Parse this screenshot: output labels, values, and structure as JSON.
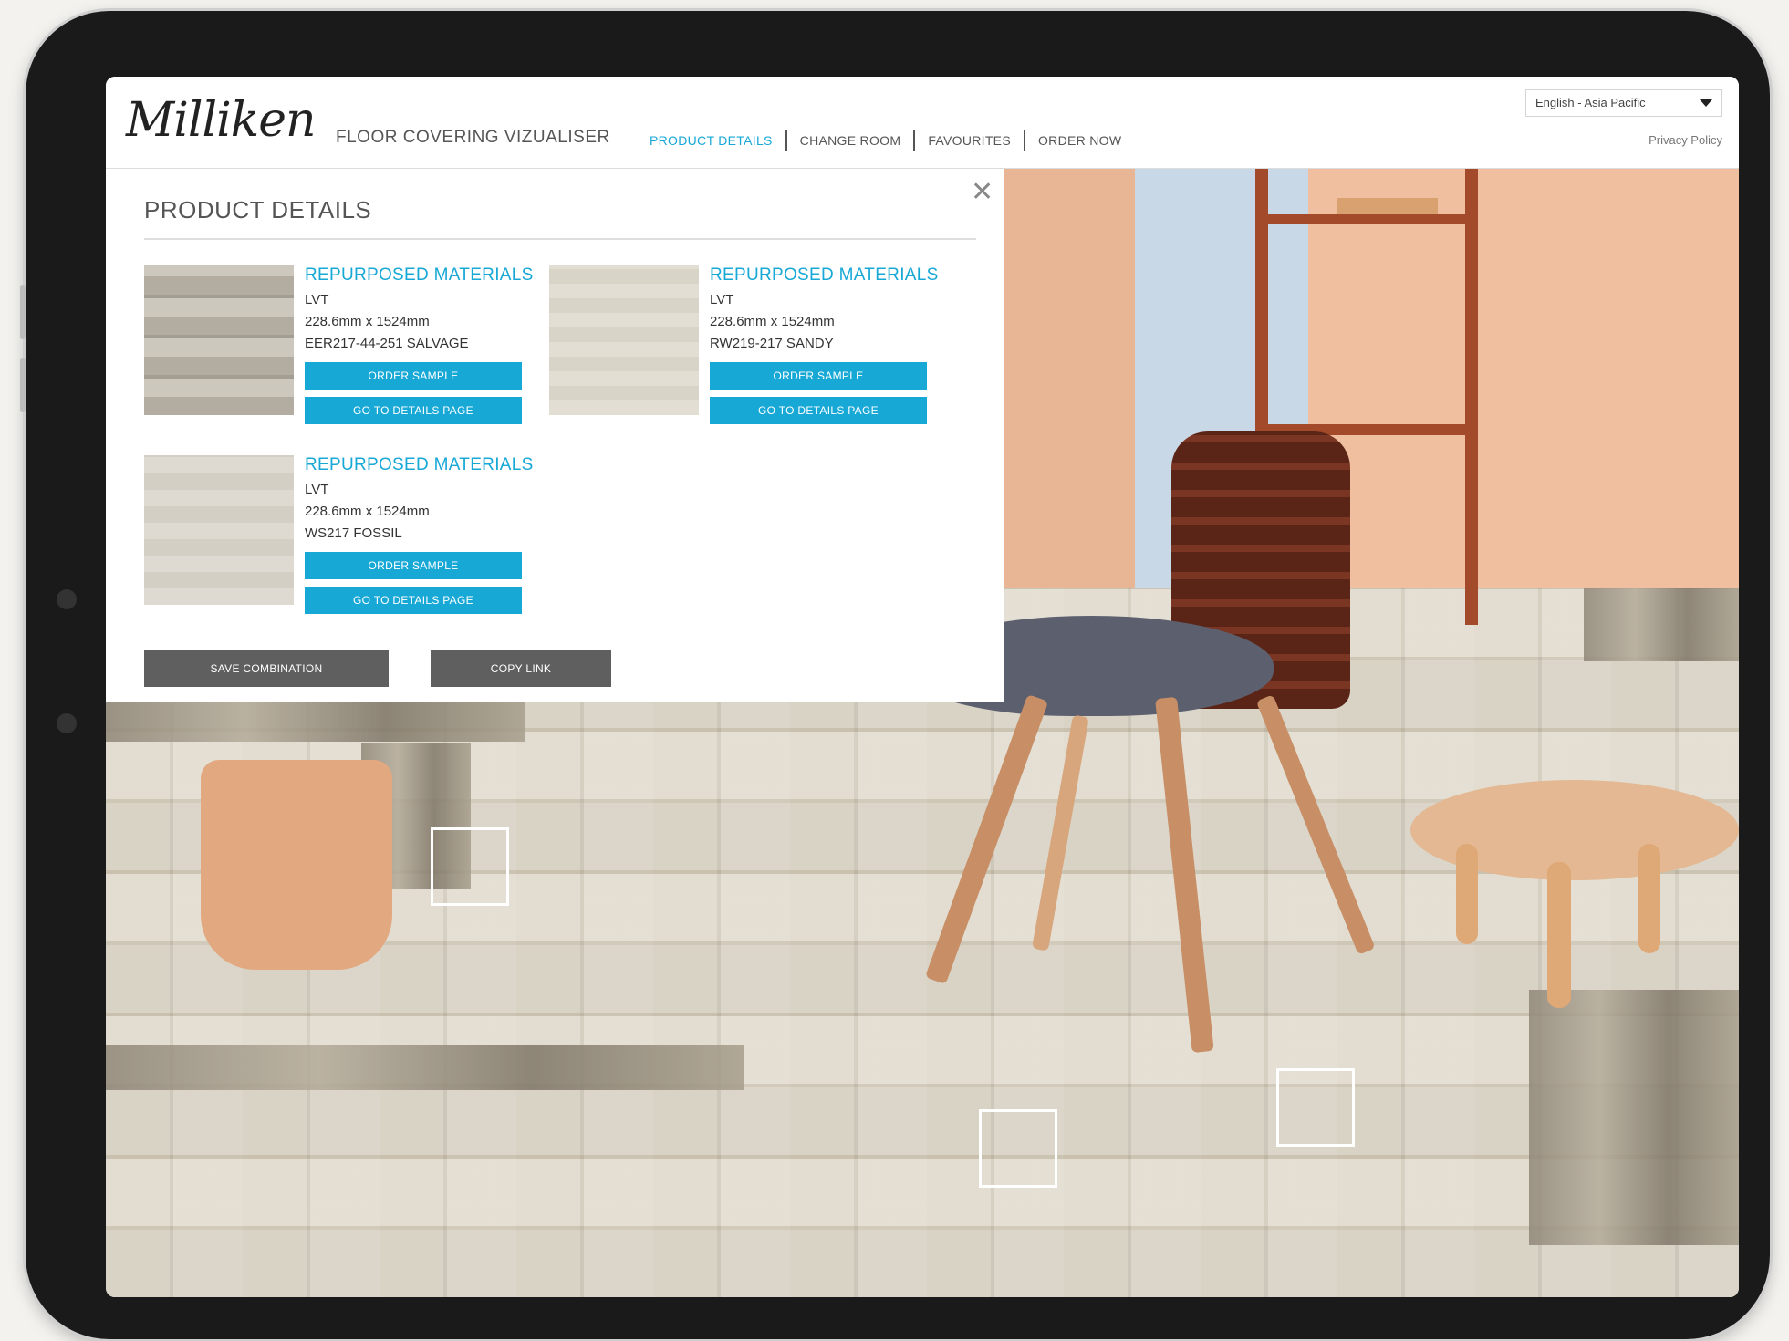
{
  "header": {
    "logo": "Milliken",
    "app_title": "FLOOR COVERING VIZUALISER",
    "nav": [
      "PRODUCT DETAILS",
      "CHANGE ROOM",
      "FAVOURITES",
      "ORDER NOW"
    ],
    "active_nav": "PRODUCT DETAILS",
    "language": "English - Asia Pacific",
    "privacy": "Privacy Policy"
  },
  "panel": {
    "title": "PRODUCT DETAILS",
    "products": [
      {
        "name": "REPURPOSED MATERIALS",
        "type": "LVT",
        "size": "228.6mm x 1524mm",
        "code": "EER217-44-251 SALVAGE",
        "swatch_color": "#bfbab0",
        "order_label": "ORDER SAMPLE",
        "details_label": "GO TO DETAILS PAGE"
      },
      {
        "name": "REPURPOSED MATERIALS",
        "type": "LVT",
        "size": "228.6mm x 1524mm",
        "code": "RW219-217 SANDY",
        "swatch_color": "#e0dcd2",
        "order_label": "ORDER SAMPLE",
        "details_label": "GO TO DETAILS PAGE"
      },
      {
        "name": "REPURPOSED MATERIALS",
        "type": "LVT",
        "size": "228.6mm x 1524mm",
        "code": "WS217 FOSSIL",
        "swatch_color": "#ddd9d1",
        "order_label": "ORDER SAMPLE",
        "details_label": "GO TO DETAILS PAGE"
      }
    ],
    "save_label": "SAVE COMBINATION",
    "copy_label": "COPY LINK"
  },
  "colors": {
    "accent": "#17a8d6",
    "button_grey": "#5f5f5f"
  },
  "icons": {
    "close": "close-icon",
    "dropdown": "chevron-down-icon"
  }
}
